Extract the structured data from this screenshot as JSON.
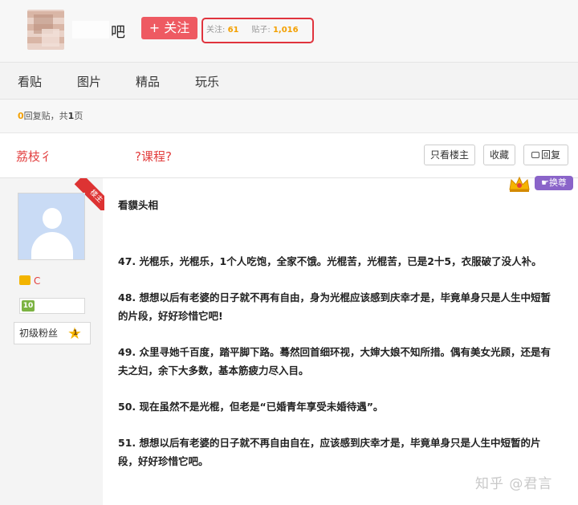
{
  "header": {
    "forum_suffix": "吧",
    "follow_label": "+ 关注",
    "stats": {
      "follow_label": "关注:",
      "follow_count": "61",
      "posts_label": "贴子:",
      "posts_count": "1,016"
    }
  },
  "nav": {
    "tabs": [
      "看贴",
      "图片",
      "精品",
      "玩乐"
    ]
  },
  "info_bar": {
    "reply_count": "0",
    "reply_text": "回复贴，共",
    "page_count": "1",
    "page_suffix": "页"
  },
  "thread": {
    "title_start": "荔枝彳",
    "title_end": "?课程?",
    "buttons": {
      "only_op": "只看楼主",
      "favorite": "收藏",
      "reply": "回复"
    }
  },
  "author": {
    "floor_badge": "楼主",
    "name_visible": "C",
    "level": "10",
    "fan_level_label": "初级粉丝",
    "fan_level_number": "1"
  },
  "post": {
    "swap_label": "换尊",
    "paragraphs": [
      "看貘头相",
      "47. 光棍乐，光棍乐，1个人吃饱，全家不饿。光棍苦，光棍苦，已是2十5，衣服破了没人补。",
      "48. 想想以后有老婆的日子就不再有自由，身为光棍应该感到庆幸才是，毕竟单身只是人生中短暂的片段，好好珍惜它吧!",
      "49. 众里寻她千百度，踏平脚下路。蓦然回首细环视，大婶大娘不知所措。偶有美女光顾，还是有夫之妇，余下大多数，基本筋疲力尽入目。",
      "50. 现在虽然不是光棍，但老是“已婚青年享受未婚待遇”。",
      "51. 想想以后有老婆的日子就不再自由自在，应该感到庆幸才是，毕竟单身只是人生中短暂的片段，好好珍惜它吧。"
    ]
  },
  "watermark": "知乎 @君言"
}
